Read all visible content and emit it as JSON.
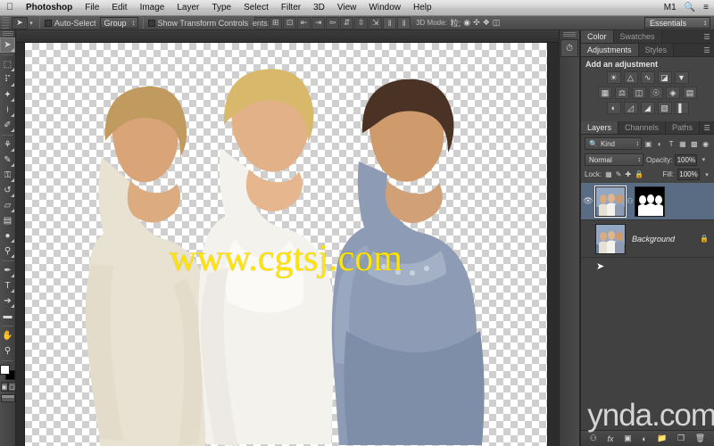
{
  "app": {
    "name": "Photoshop"
  },
  "menubar": {
    "apple_icon": "apple-icon",
    "items": [
      "Photoshop",
      "File",
      "Edit",
      "Image",
      "Layer",
      "Type",
      "Select",
      "Filter",
      "3D",
      "View",
      "Window",
      "Help"
    ],
    "status": {
      "input_source": "M1",
      "search_icon": "search-icon",
      "list_icon": "list-icon"
    }
  },
  "options_bar": {
    "tool_icon": "move-tool-icon",
    "auto_select_label": "Auto-Select",
    "auto_select_target": "Group",
    "show_transform_label": "Show Transform Controls",
    "align_icons": [
      "align-top-edges-icon",
      "align-vertical-centers-icon",
      "align-bottom-edges-icon",
      "align-left-edges-icon",
      "align-horizontal-centers-icon",
      "align-right-edges-icon",
      "distribute-top-icon",
      "distribute-vertical-center-icon",
      "distribute-bottom-icon",
      "distribute-left-icon",
      "distribute-horizontal-center-icon"
    ],
    "mode3d_label": "3D Mode:",
    "mode3d_icons": [
      "rotate-3d-icon",
      "roll-3d-icon",
      "pan-3d-icon",
      "slide-3d-icon",
      "scale-3d-icon"
    ],
    "workspace": "Essentials"
  },
  "toolbar": {
    "tools": [
      {
        "name": "move-tool",
        "glyph": "➤",
        "active": true
      },
      {
        "name": "rectangular-marquee-tool",
        "glyph": "⬚",
        "active": false
      },
      {
        "name": "lasso-tool",
        "glyph": "❁",
        "active": false
      },
      {
        "name": "quick-selection-tool",
        "glyph": "✦",
        "active": false
      },
      {
        "name": "crop-tool",
        "glyph": "⌗",
        "active": false
      },
      {
        "name": "eyedropper-tool",
        "glyph": "✐",
        "active": false
      },
      {
        "name": "spot-healing-brush-tool",
        "glyph": "☂",
        "active": false
      },
      {
        "name": "brush-tool",
        "glyph": "✎",
        "active": false
      },
      {
        "name": "clone-stamp-tool",
        "glyph": "⚓",
        "active": false
      },
      {
        "name": "history-brush-tool",
        "glyph": "↺",
        "active": false
      },
      {
        "name": "eraser-tool",
        "glyph": "▱",
        "active": false
      },
      {
        "name": "gradient-tool",
        "glyph": "▤",
        "active": false
      },
      {
        "name": "blur-tool",
        "glyph": "●",
        "active": false
      },
      {
        "name": "dodge-tool",
        "glyph": "⚲",
        "active": false
      },
      {
        "name": "pen-tool",
        "glyph": "✒",
        "active": false
      },
      {
        "name": "horizontal-type-tool",
        "glyph": "T",
        "active": false
      },
      {
        "name": "path-selection-tool",
        "glyph": "↖",
        "active": false
      },
      {
        "name": "rectangle-shape-tool",
        "glyph": "▬",
        "active": false
      },
      {
        "name": "hand-tool",
        "glyph": "✋",
        "active": false
      },
      {
        "name": "zoom-tool",
        "glyph": "⚲",
        "active": false
      }
    ],
    "foreground_color": "#ffffff",
    "background_color": "#000000",
    "quick_mask_icons": [
      "standard-mode-icon",
      "quick-mask-mode-icon"
    ],
    "screen_mode_icon": "screen-mode-icon"
  },
  "color_panel": {
    "tabs": [
      {
        "label": "Color",
        "active": true
      },
      {
        "label": "Swatches",
        "active": false
      }
    ],
    "menu_icon": "panel-menu-icon"
  },
  "adjustments_panel": {
    "tabs": [
      {
        "label": "Adjustments",
        "active": true
      },
      {
        "label": "Styles",
        "active": false
      }
    ],
    "menu_icon": "panel-menu-icon",
    "title": "Add an adjustment",
    "rows": [
      [
        "brightness-contrast-icon",
        "levels-icon",
        "curves-icon",
        "exposure-icon",
        "vibrance-icon"
      ],
      [
        "hue-saturation-icon",
        "color-balance-icon",
        "black-white-icon",
        "photo-filter-icon",
        "channel-mixer-icon",
        "color-lookup-icon"
      ],
      [
        "invert-icon",
        "posterize-icon",
        "threshold-icon",
        "gradient-map-icon",
        "selective-color-icon"
      ]
    ]
  },
  "layers_panel": {
    "tabs": [
      {
        "label": "Layers",
        "active": true
      },
      {
        "label": "Channels",
        "active": false
      },
      {
        "label": "Paths",
        "active": false
      }
    ],
    "menu_icon": "panel-menu-icon",
    "filter": {
      "search_icon": "search-icon",
      "kind_label": "Kind",
      "type_icons": [
        "filter-pixel-icon",
        "filter-adjustment-icon",
        "filter-type-icon",
        "filter-shape-icon",
        "filter-smart-object-icon"
      ],
      "toggle_icon": "filter-toggle-icon"
    },
    "blend_mode": "Normal",
    "opacity_label": "Opacity:",
    "opacity_value": "100%",
    "lock_label": "Lock:",
    "lock_icons": [
      "lock-transparent-pixels-icon",
      "lock-image-pixels-icon",
      "lock-position-icon",
      "lock-all-icon"
    ],
    "fill_label": "Fill:",
    "fill_value": "100%",
    "layers": [
      {
        "name": "",
        "visible": true,
        "selected": true,
        "has_mask": true,
        "link_icon": "layer-mask-link-icon",
        "thumbnail": "photo-thumbnail",
        "mask_thumbnail": "layer-mask-thumbnail"
      },
      {
        "name": "Background",
        "visible": false,
        "selected": false,
        "has_mask": false,
        "locked": true,
        "lock_icon": "lock-icon",
        "thumbnail": "photo-thumbnail"
      }
    ],
    "footer_icons": [
      "link-layers-icon",
      "layer-style-fx-icon",
      "add-layer-mask-icon",
      "new-fill-adjustment-layer-icon",
      "new-group-icon",
      "new-layer-icon",
      "delete-layer-icon"
    ]
  },
  "collapsed_dock": {
    "grip": "panel-grip",
    "buttons": [
      "history-panel-icon"
    ]
  },
  "canvas": {
    "watermark": "www.cgtsj.com",
    "transparency": true
  },
  "overlay": {
    "lynda_watermark": "ynda.com",
    "cursor": "mouse-cursor"
  }
}
